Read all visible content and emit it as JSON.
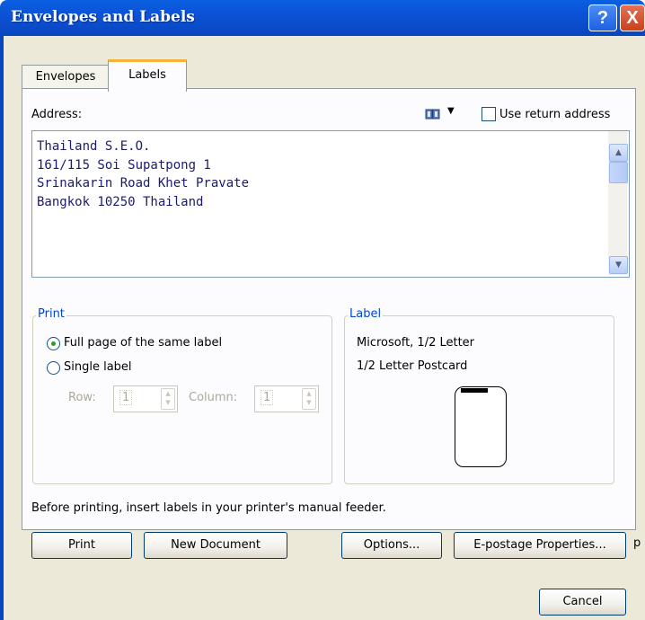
{
  "window": {
    "title": "Envelopes and Labels",
    "help_glyph": "?",
    "close_glyph": "X"
  },
  "tabs": [
    {
      "label": "Envelopes",
      "selected": false
    },
    {
      "label": "Labels",
      "selected": true
    }
  ],
  "address": {
    "label": "Address:",
    "use_return_address_label": "Use return address",
    "use_return_address_checked": false,
    "value": "Thailand S.E.O.\n161/115 Soi Supatpong 1\nSrinakarin Road Khet Pravate\nBangkok 10250 Thailand",
    "book_dropdown_glyph": "▼"
  },
  "print_group": {
    "title": "Print",
    "options": [
      {
        "label": "Full page of the same label",
        "selected": true
      },
      {
        "label": "Single label",
        "selected": false
      }
    ],
    "row_label": "Row:",
    "row_value": "1",
    "column_label": "Column:",
    "column_value": "1"
  },
  "label_group": {
    "title": "Label",
    "vendor": "Microsoft, 1/2 Letter",
    "product": "1/2 Letter Postcard"
  },
  "hint": "Before printing, insert labels in your printer's manual feeder.",
  "buttons": {
    "print": "Print",
    "new_document": "New Document",
    "options": "Options...",
    "epostage": "E-postage Properties...",
    "cancel": "Cancel"
  },
  "stray_text": "p",
  "colors": {
    "titlebar": "#0c52d6",
    "dialog_bg": "#ece9d8",
    "group_title": "#0046d5",
    "tab_highlight": "#f6b33b"
  }
}
